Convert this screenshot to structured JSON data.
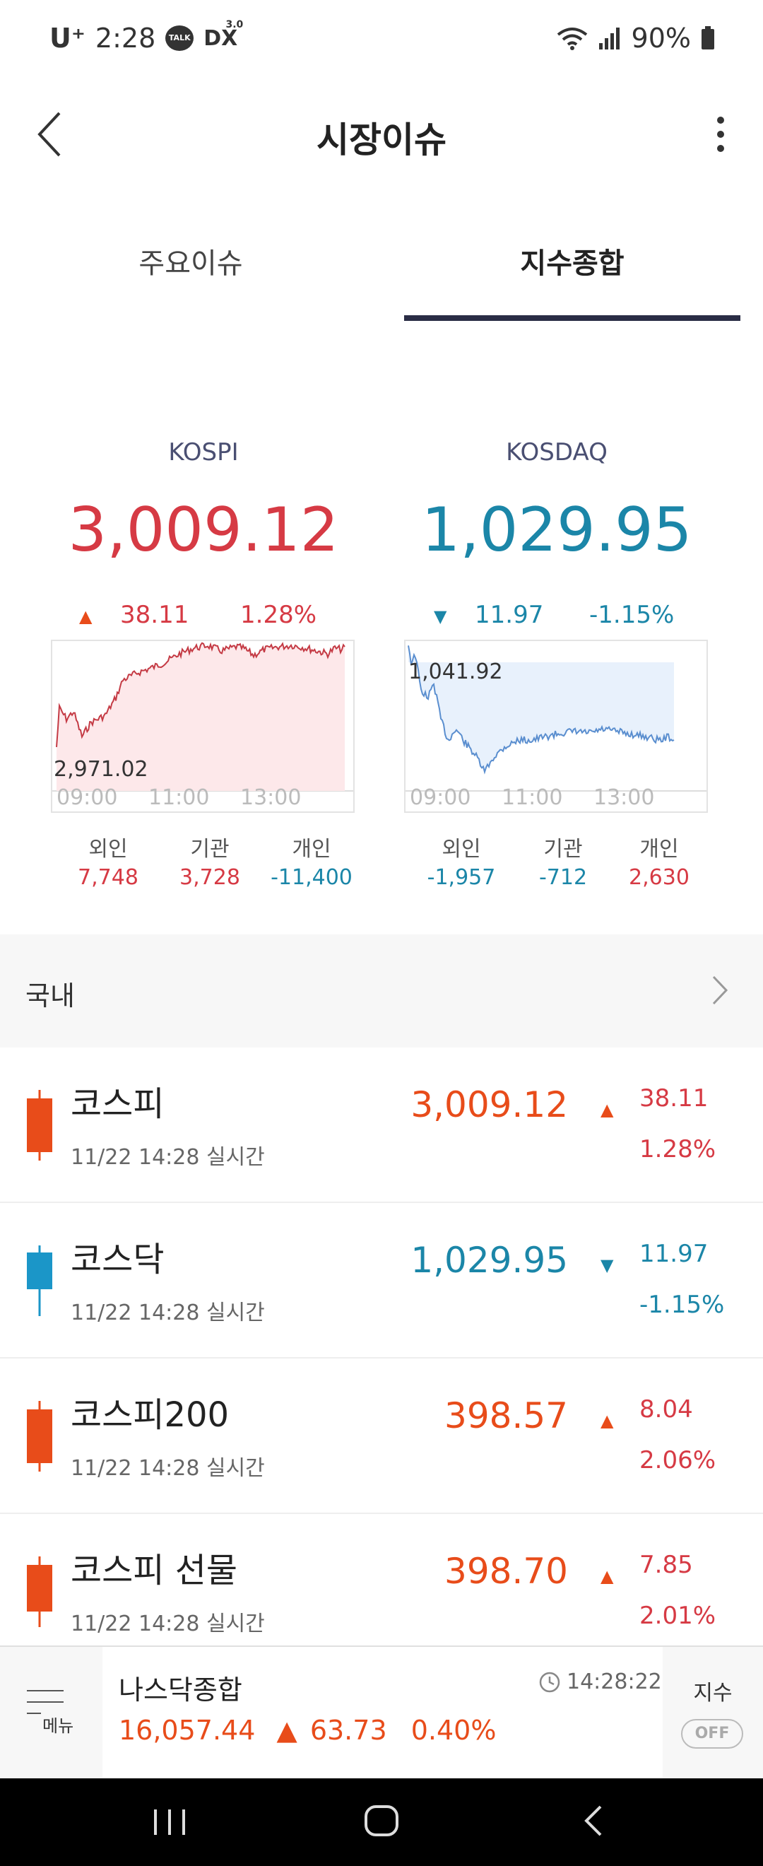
{
  "status_bar": {
    "carrier": "U⁺",
    "time": "2:28",
    "talk_badge": "TALK",
    "dx_badge": "DX",
    "dx_sup": "3.0",
    "battery": "90%"
  },
  "header": {
    "title": "시장이슈"
  },
  "tabs": [
    {
      "label": "주요이슈"
    },
    {
      "label": "지수종합"
    }
  ],
  "kospi": {
    "name": "KOSPI",
    "value": "3,009.12",
    "change": "38.11",
    "change_pct": "1.28%",
    "chart_low_label": "2,971.02",
    "x_ticks": [
      "09:00",
      "11:00",
      "13:00"
    ],
    "investors": [
      {
        "label": "외인",
        "value": "7,748"
      },
      {
        "label": "기관",
        "value": "3,728"
      },
      {
        "label": "개인",
        "value": "-11,400"
      }
    ]
  },
  "kosdaq": {
    "name": "KOSDAQ",
    "value": "1,029.95",
    "change": "11.97",
    "change_pct": "-1.15%",
    "chart_high_label": "1,041.92",
    "x_ticks": [
      "09:00",
      "11:00",
      "13:00"
    ],
    "investors": [
      {
        "label": "외인",
        "value": "-1,957"
      },
      {
        "label": "기관",
        "value": "-712"
      },
      {
        "label": "개인",
        "value": "2,630"
      }
    ]
  },
  "domestic": {
    "title": "국내",
    "rows": [
      {
        "name": "코스피",
        "time": "11/22 14:28 실시간",
        "price": "3,009.12",
        "change": "38.11",
        "pct": "1.28%",
        "dir": "up"
      },
      {
        "name": "코스닥",
        "time": "11/22 14:28 실시간",
        "price": "1,029.95",
        "change": "11.97",
        "pct": "-1.15%",
        "dir": "down"
      },
      {
        "name": "코스피200",
        "time": "11/22 14:28 실시간",
        "price": "398.57",
        "change": "8.04",
        "pct": "2.06%",
        "dir": "up"
      },
      {
        "name": "코스피 선물",
        "time": "11/22 14:28 실시간",
        "price": "398.70",
        "change": "7.85",
        "pct": "2.01%",
        "dir": "up"
      }
    ]
  },
  "ticker": {
    "menu_label": "메뉴",
    "name": "나스닥종합",
    "time": "14:28:22",
    "price": "16,057.44",
    "change": "63.73",
    "pct": "0.40%",
    "index_label": "지수",
    "toggle": "OFF"
  },
  "colors": {
    "up": "#e84c1a",
    "down": "#1b86a8",
    "kospi_value": "#d63a44",
    "tab_indicator": "#2a2d45"
  }
}
